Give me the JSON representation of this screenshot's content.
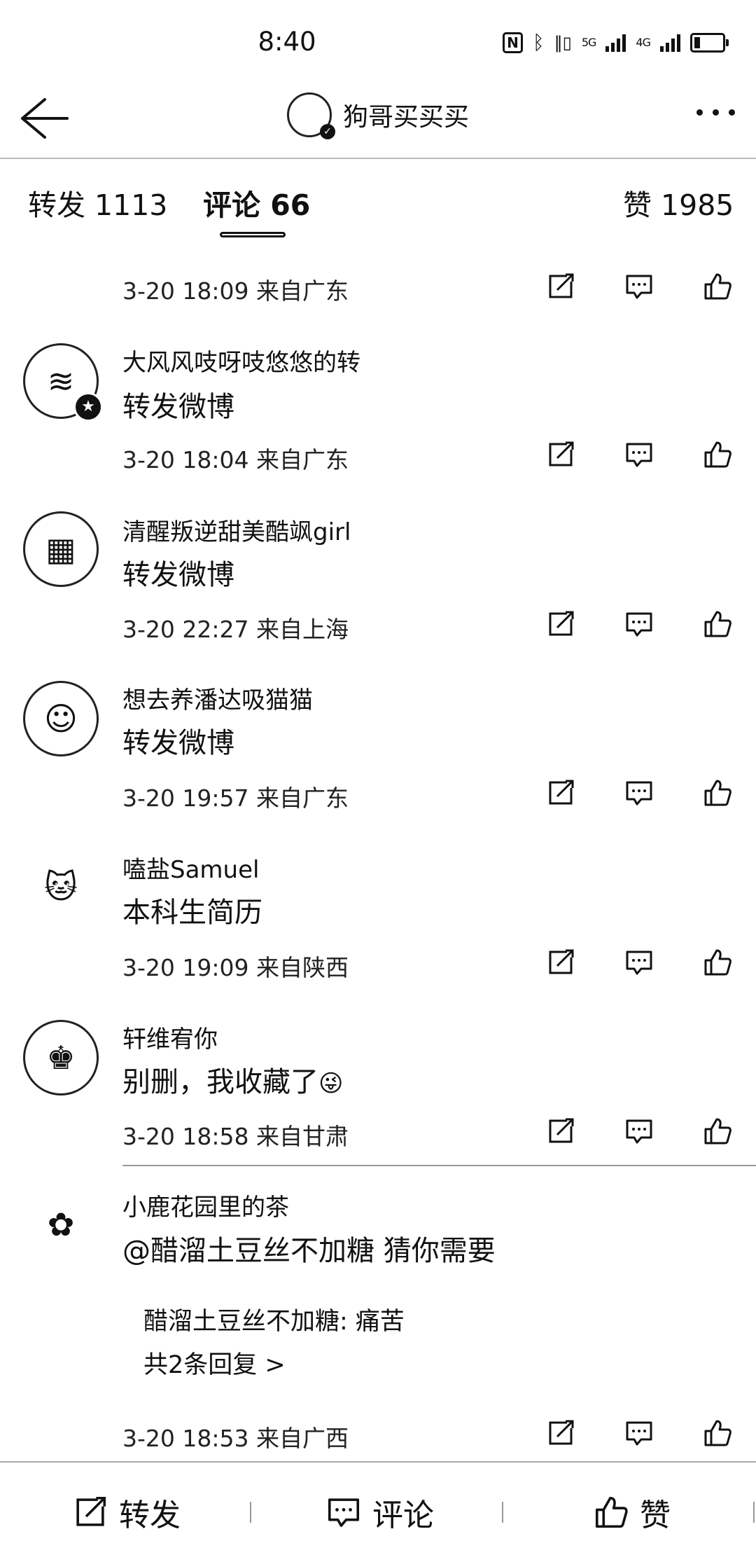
{
  "status_bar": {
    "time": "8:40",
    "net1": "5G",
    "net2": "4G"
  },
  "header": {
    "title": "狗哥买买买"
  },
  "tabs": [
    {
      "label": "转发 1113"
    },
    {
      "label": "评论 66"
    },
    {
      "label": "赞 1985"
    }
  ],
  "comments": [
    {
      "username": "",
      "text": "",
      "meta": "3-20 18:09 来自广东"
    },
    {
      "username": "大风风吱呀吱悠悠的转",
      "text": "转发微博",
      "meta": "3-20 18:04 来自广东"
    },
    {
      "username": "清醒叛逆甜美酷飒girl",
      "text": "转发微博",
      "meta": "3-20 22:27 来自上海"
    },
    {
      "username": "想去养潘达吸猫猫",
      "text": "转发微博",
      "meta": "3-20 19:57 来自广东"
    },
    {
      "username": "嗑盐Samuel",
      "text": "本科生简历",
      "meta": "3-20 19:09 来自陕西"
    },
    {
      "username": "轩维宥你",
      "text": "别删，我收藏了",
      "emoji": "😜",
      "meta": "3-20 18:58 来自甘肃"
    },
    {
      "username": "小鹿花园里的茶",
      "text": "@醋溜土豆丝不加糖 猜你需要",
      "meta": "3-20 18:53 来自广西",
      "reply_preview": "醋溜土豆丝不加糖: 痛苦",
      "reply_count": "共2条回复 >"
    }
  ],
  "bottom_bar": {
    "repost": "转发",
    "comment": "评论",
    "like": "赞"
  }
}
